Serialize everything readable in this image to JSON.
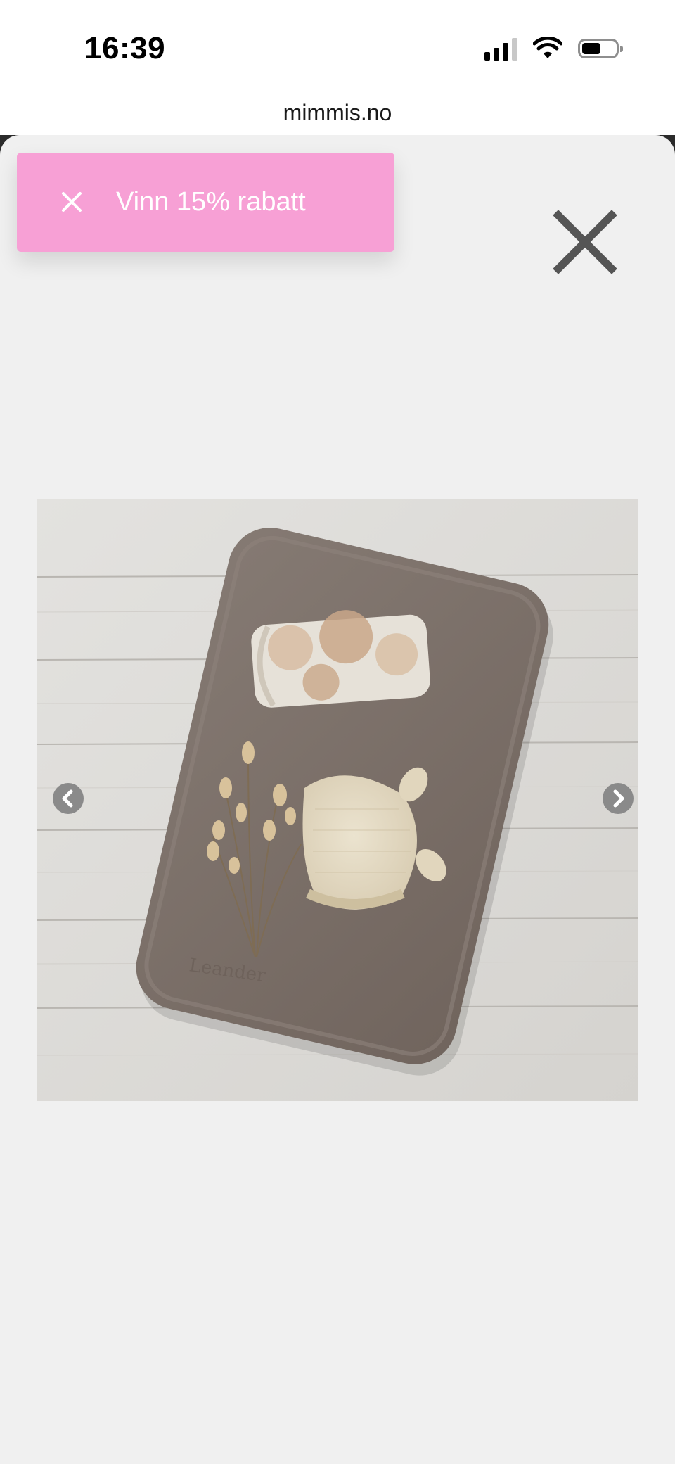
{
  "status_bar": {
    "time": "16:39"
  },
  "browser": {
    "url": "mimmis.no"
  },
  "popup": {
    "discount_label": "Vinn 15% rabatt",
    "background_color": "#f7a0d5"
  },
  "lightbox": {
    "close_icon": "close-icon",
    "prev_icon": "chevron-left-icon",
    "next_icon": "chevron-right-icon",
    "background_color": "#f0f0f0"
  },
  "product_image": {
    "embossed_brand": "Leander"
  }
}
